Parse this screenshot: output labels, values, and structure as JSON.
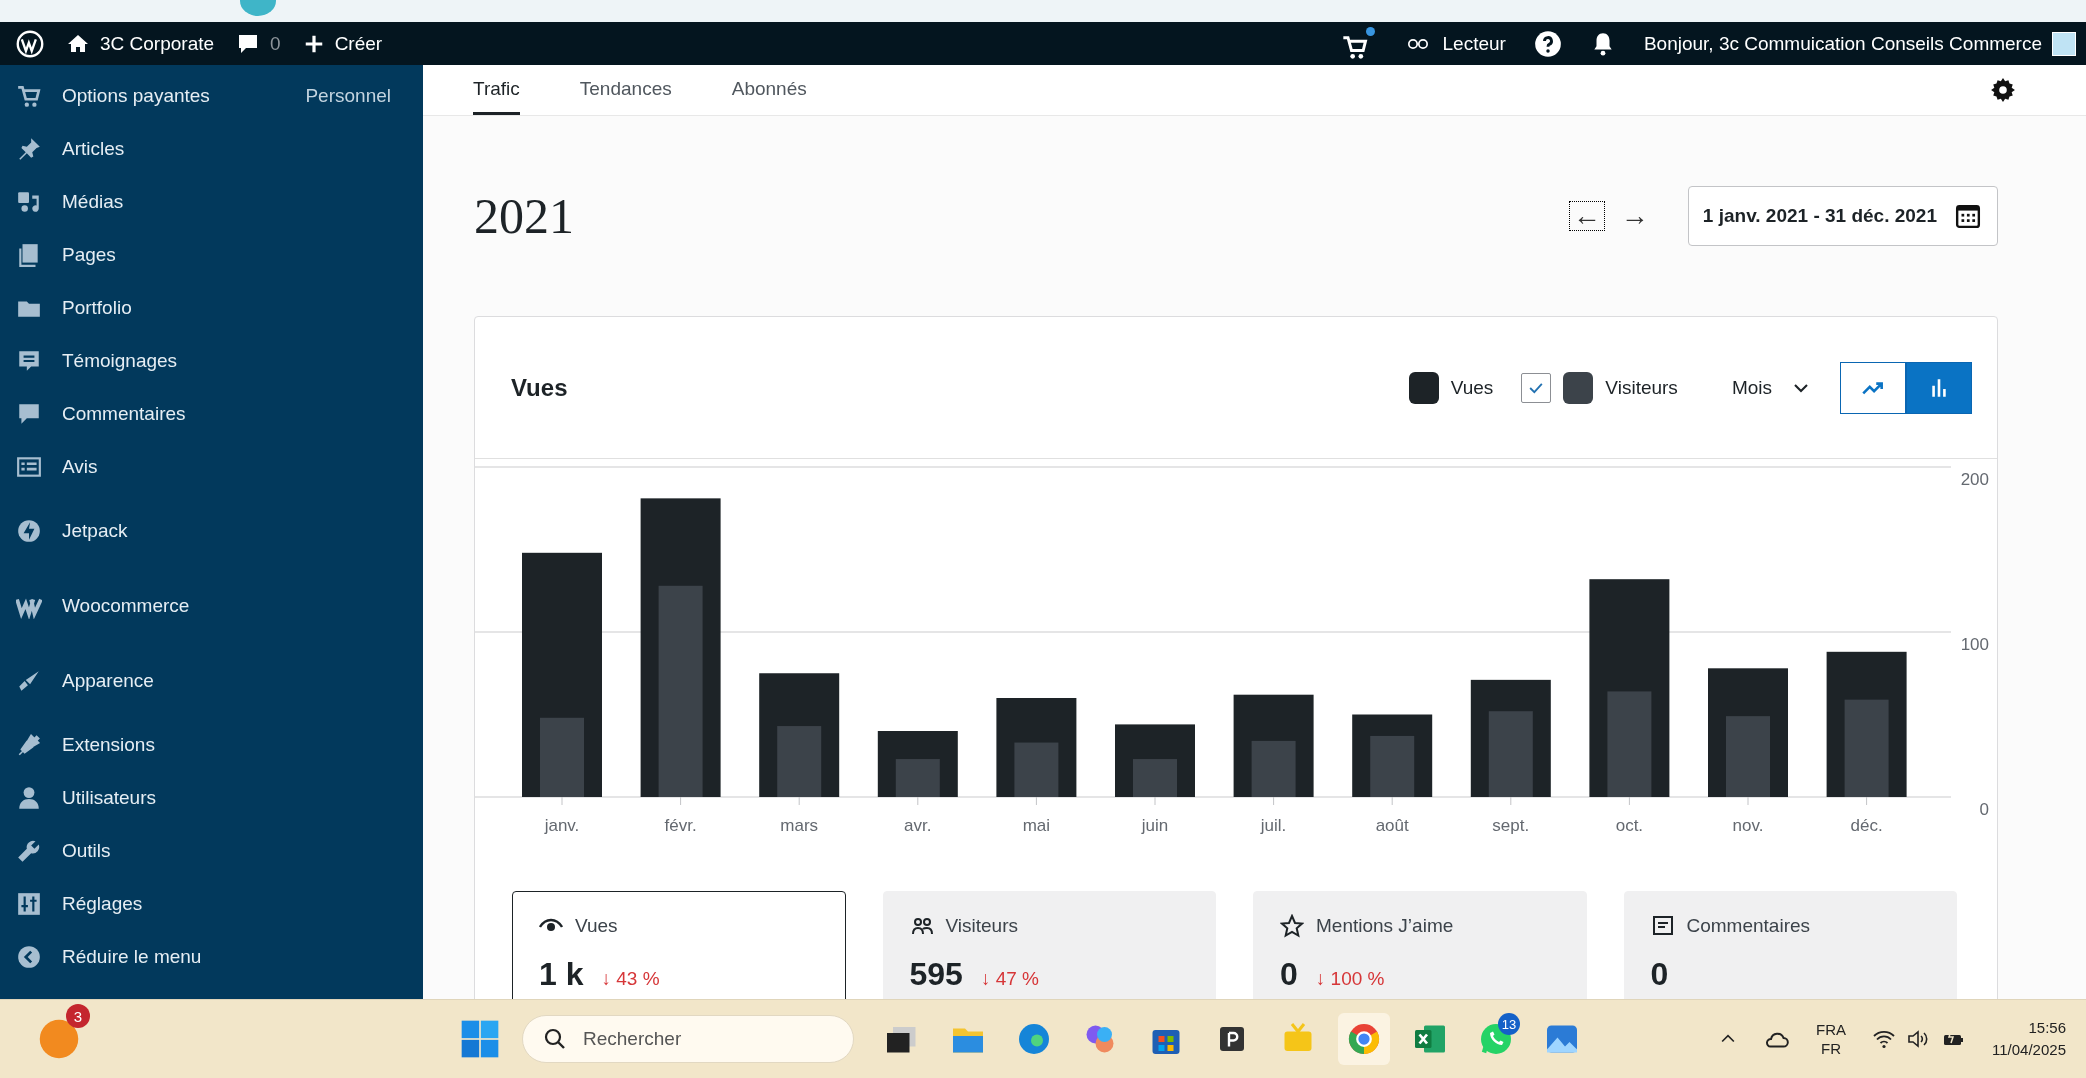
{
  "admin_bar": {
    "site": "3C Corporate",
    "comments": "0",
    "create": "Créer",
    "reader": "Lecteur",
    "greeting": "Bonjour, 3c Commuication Conseils Commerce"
  },
  "sidebar": {
    "items": [
      {
        "label": "Options payantes",
        "badge": "Personnel",
        "kind": "menu"
      },
      {
        "label": "Articles",
        "kind": "menu"
      },
      {
        "label": "Médias",
        "kind": "menu"
      },
      {
        "label": "Pages",
        "kind": "menu"
      },
      {
        "label": "Portfolio",
        "kind": "menu"
      },
      {
        "label": "Témoignages",
        "kind": "menu"
      },
      {
        "label": "Commentaires",
        "kind": "menu"
      },
      {
        "label": "Avis",
        "kind": "menu"
      },
      {
        "label": "Jetpack",
        "kind": "plugin"
      },
      {
        "label": "Woocommerce",
        "kind": "plugin"
      },
      {
        "label": "Apparence",
        "kind": "plugin"
      },
      {
        "label": "Extensions",
        "kind": "menu"
      },
      {
        "label": "Utilisateurs",
        "kind": "menu"
      },
      {
        "label": "Outils",
        "kind": "menu"
      },
      {
        "label": "Réglages",
        "kind": "menu"
      },
      {
        "label": "Réduire le menu",
        "kind": "menu"
      }
    ]
  },
  "tabs": [
    {
      "label": "Trafic",
      "selected": true
    },
    {
      "label": "Tendances",
      "selected": false
    },
    {
      "label": "Abonnés",
      "selected": false
    }
  ],
  "period": {
    "title": "2021",
    "previous": "←",
    "next": "→",
    "range": "1 janv. 2021 - 31 déc. 2021"
  },
  "chart_card": {
    "title": "Vues",
    "legend": [
      {
        "kind": "fixed"
      },
      {
        "kind": "toggle",
        "checked": true
      }
    ],
    "interval": "Mois",
    "view_buttons": [
      {
        "kind": "line",
        "selected": false
      },
      {
        "kind": "bar",
        "selected": true
      }
    ],
    "chart_data": {
      "type": "bar",
      "categories": [
        "janv.",
        "févr.",
        "mars",
        "avr.",
        "mai",
        "juin",
        "juil.",
        "août",
        "sept.",
        "oct.",
        "nov.",
        "déc."
      ],
      "series": [
        {
          "name": "Vues",
          "color": "#1d2327",
          "values": [
            148,
            181,
            75,
            40,
            60,
            44,
            62,
            50,
            71,
            132,
            78,
            88
          ]
        },
        {
          "name": "Visiteurs",
          "color": "#3c434a",
          "values": [
            48,
            128,
            43,
            23,
            33,
            23,
            34,
            37,
            52,
            64,
            49,
            59
          ]
        }
      ],
      "ylim": [
        0,
        200
      ],
      "yticks": [
        0,
        100,
        200
      ]
    }
  },
  "stats": [
    {
      "label": "Vues",
      "value": "1 k",
      "change": "↓ 43 %",
      "selected": true
    },
    {
      "label": "Visiteurs",
      "value": "595",
      "change": "↓ 47 %",
      "selected": false
    },
    {
      "label": "Mentions J’aime",
      "value": "0",
      "change": "↓ 100 %",
      "selected": false
    },
    {
      "label": "Commentaires",
      "value": "0",
      "selected": false
    }
  ],
  "taskbar": {
    "notification_count": "3",
    "search_placeholder": "Rechercher",
    "apps": [
      {
        "active": false
      },
      {
        "active": false
      },
      {
        "active": false
      },
      {
        "active": false
      },
      {
        "active": false
      },
      {
        "active": false
      },
      {
        "active": false
      },
      {
        "active": true
      },
      {
        "active": false
      },
      {
        "active": false,
        "badge": "13"
      },
      {
        "active": false
      }
    ],
    "lang": "FRA",
    "layout": "FR",
    "time": "15:56",
    "date": "11/04/2025"
  }
}
